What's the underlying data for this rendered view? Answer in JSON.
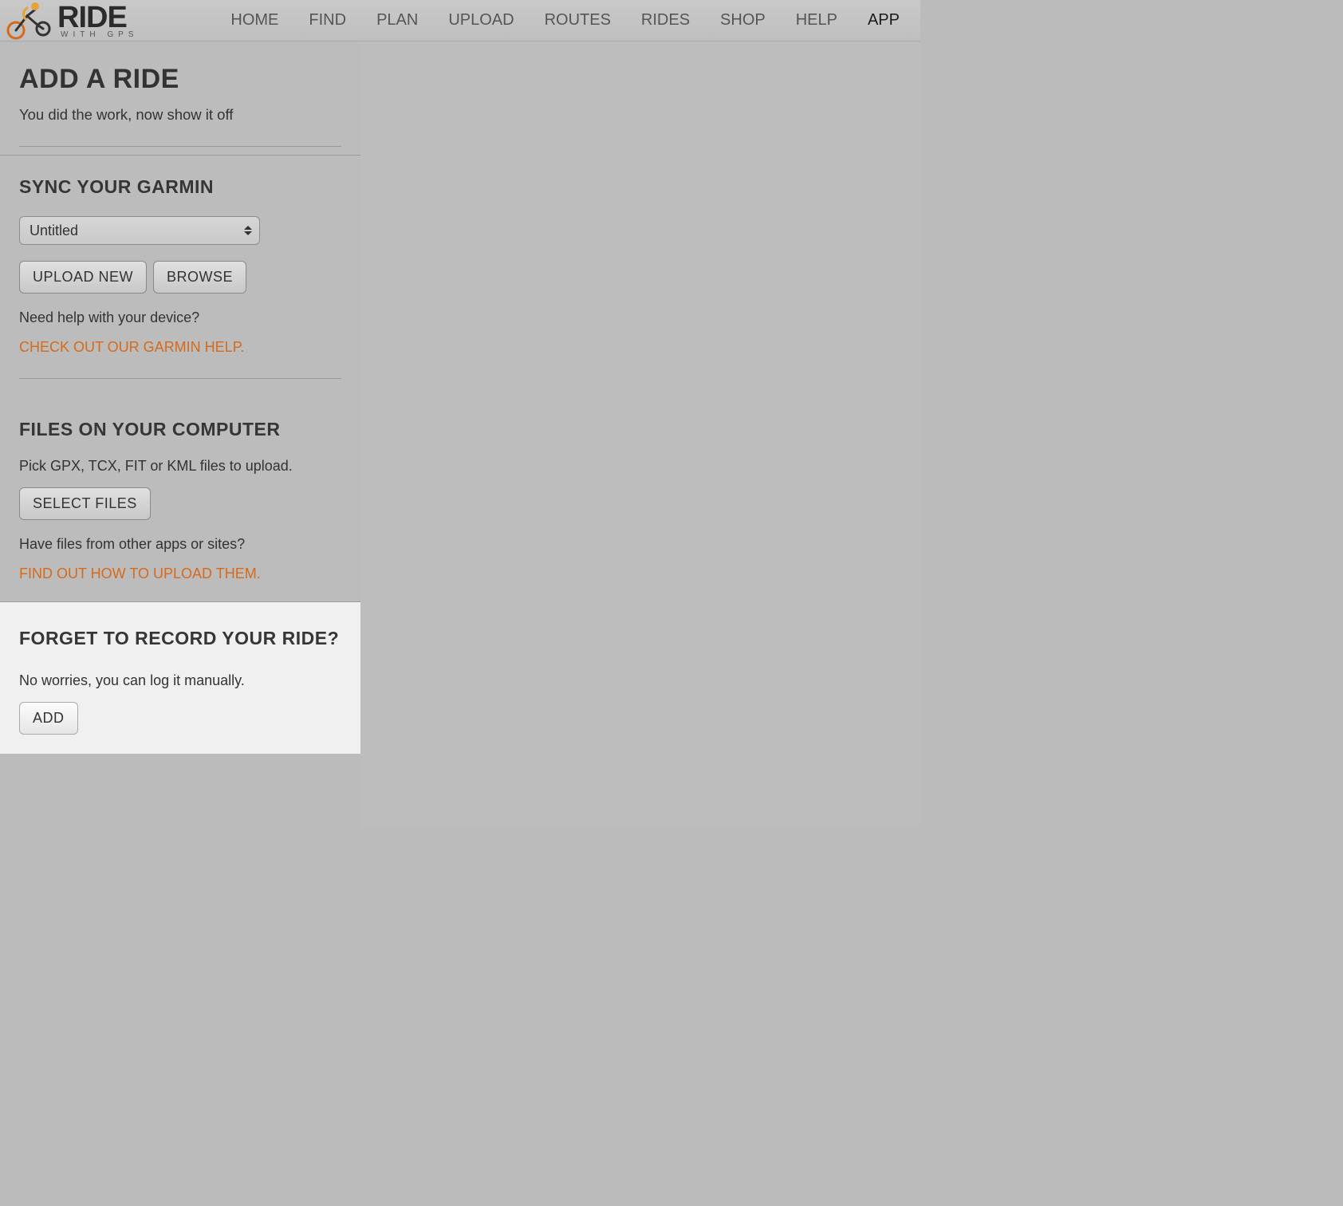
{
  "header": {
    "logo_main": "RIDE",
    "logo_sub": "WITH GPS",
    "nav": [
      {
        "label": "HOME",
        "active": false
      },
      {
        "label": "FIND",
        "active": false
      },
      {
        "label": "PLAN",
        "active": false
      },
      {
        "label": "UPLOAD",
        "active": false
      },
      {
        "label": "ROUTES",
        "active": false
      },
      {
        "label": "RIDES",
        "active": false
      },
      {
        "label": "SHOP",
        "active": false
      },
      {
        "label": "HELP",
        "active": false
      },
      {
        "label": "APP",
        "active": true
      }
    ]
  },
  "sidebar": {
    "page_title": "ADD A RIDE",
    "page_subtitle": "You did the work, now show it off",
    "garmin": {
      "title": "SYNC YOUR GARMIN",
      "select_value": "Untitled",
      "upload_btn": "UPLOAD NEW",
      "browse_btn": "BROWSE",
      "help_text": "Need help with your device?",
      "help_link": "CHECK OUT OUR GARMIN HELP."
    },
    "files": {
      "title": "FILES ON YOUR COMPUTER",
      "instruction": "Pick GPX, TCX, FIT or KML files to upload.",
      "select_btn": "SELECT FILES",
      "help_text": "Have files from other apps or sites?",
      "help_link": "FIND OUT HOW TO UPLOAD THEM."
    },
    "forgot": {
      "title": "FORGET TO RECORD YOUR RIDE?",
      "text": "No worries, you can log it manually.",
      "add_btn": "ADD"
    }
  }
}
